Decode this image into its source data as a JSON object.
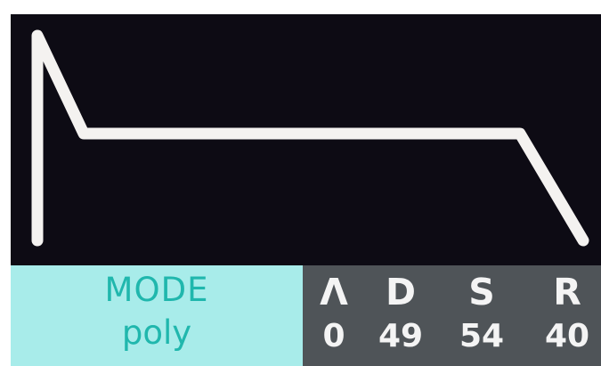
{
  "display": {
    "background_color": "#0d0b14",
    "curve_color": "#f4f2f0"
  },
  "mode": {
    "title": "MODE",
    "value": "poly",
    "panel_color": "#a8ecea",
    "text_color": "#20b7ad"
  },
  "adsr": {
    "panel_color": "#4f5458",
    "params": [
      {
        "label": "Λ",
        "value": "0"
      },
      {
        "label": "D",
        "value": "49"
      },
      {
        "label": "S",
        "value": "54"
      },
      {
        "label": "R",
        "value": "40"
      }
    ]
  }
}
